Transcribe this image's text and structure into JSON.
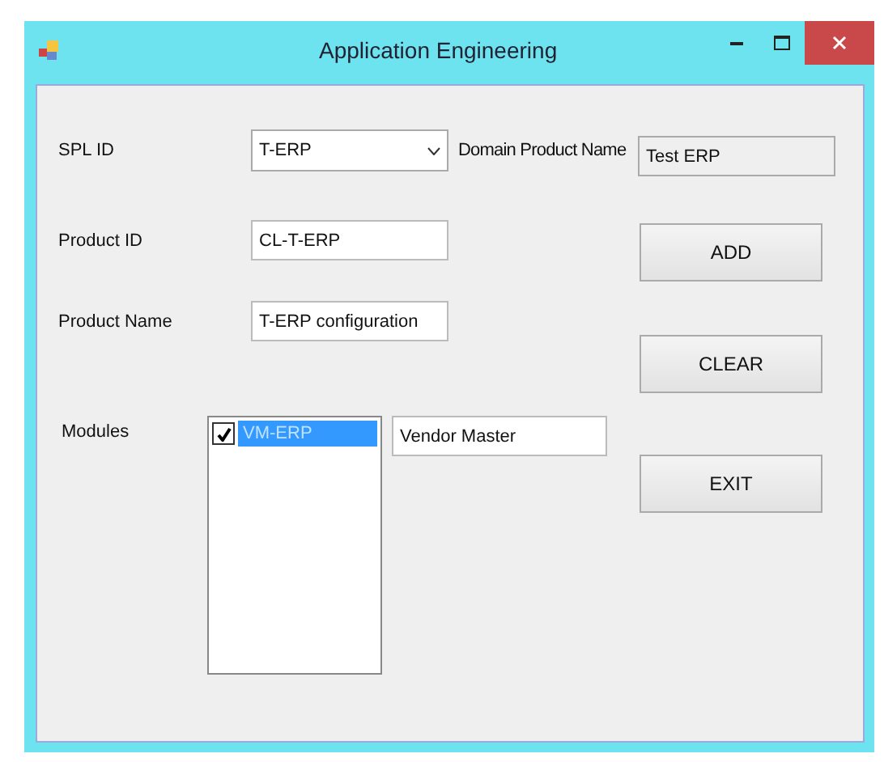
{
  "window": {
    "title": "Application Engineering"
  },
  "spl_id": {
    "label": "SPL ID",
    "value": "T-ERP"
  },
  "domain_product_name": {
    "label": "Domain Product Name",
    "value": "Test ERP"
  },
  "product_id": {
    "label": "Product ID",
    "value": "CL-T-ERP"
  },
  "product_name": {
    "label": "Product Name",
    "value": "T-ERP configuration"
  },
  "modules": {
    "label": "Modules",
    "items": [
      {
        "label": "VM-ERP",
        "checked": true,
        "selected": true
      }
    ],
    "description": "Vendor Master"
  },
  "buttons": [
    "ADD",
    "CLEAR",
    "EXIT"
  ]
}
